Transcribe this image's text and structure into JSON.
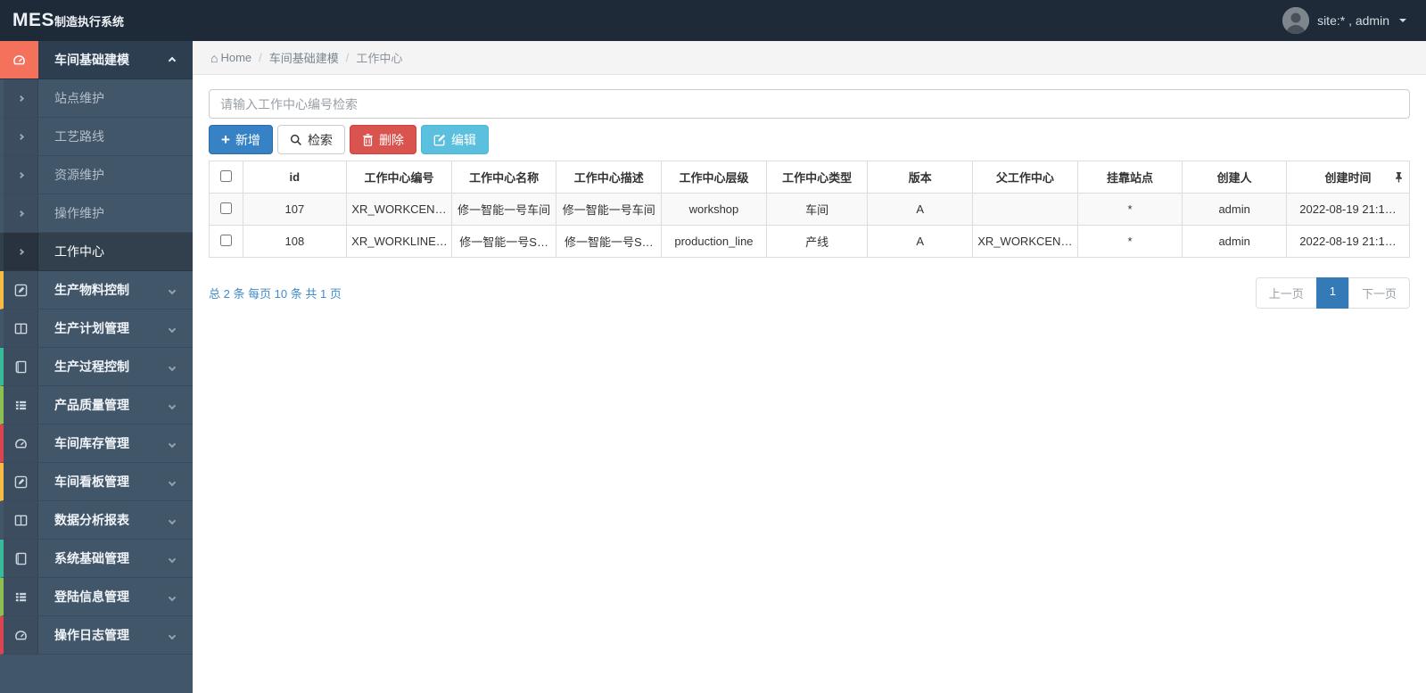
{
  "navbar": {
    "brand_bold": "MES",
    "brand_rest": "制造执行系统",
    "user_label": "site:* , admin"
  },
  "breadcrumb": {
    "home": "Home",
    "items": [
      "车间基础建模",
      "工作中心"
    ]
  },
  "sidebar": {
    "items": [
      {
        "label": "车间基础建模",
        "icon": "dashboard-icon",
        "kind": "parent",
        "expanded": true,
        "active": true,
        "icon_bg": "#f4715c"
      },
      {
        "label": "站点维护",
        "kind": "sub"
      },
      {
        "label": "工艺路线",
        "kind": "sub"
      },
      {
        "label": "资源维护",
        "kind": "sub"
      },
      {
        "label": "操作维护",
        "kind": "sub"
      },
      {
        "label": "工作中心",
        "kind": "sub",
        "active": true
      },
      {
        "label": "生产物料控制",
        "icon": "pencil-square-icon",
        "kind": "parent",
        "strip": "#f6bb42"
      },
      {
        "label": "生产计划管理",
        "icon": "columns-icon",
        "kind": "parent"
      },
      {
        "label": "生产过程控制",
        "icon": "book-icon",
        "kind": "parent",
        "strip": "#37bc9b"
      },
      {
        "label": "产品质量管理",
        "icon": "list-icon",
        "kind": "parent",
        "strip": "#8cc152"
      },
      {
        "label": "车间库存管理",
        "icon": "dashboard-icon",
        "kind": "parent",
        "strip": "#da4453"
      },
      {
        "label": "车间看板管理",
        "icon": "pencil-square-icon",
        "kind": "parent",
        "strip": "#f6bb42"
      },
      {
        "label": "数据分析报表",
        "icon": "columns-icon",
        "kind": "parent"
      },
      {
        "label": "系统基础管理",
        "icon": "book-icon",
        "kind": "parent",
        "strip": "#37bc9b"
      },
      {
        "label": "登陆信息管理",
        "icon": "list-icon",
        "kind": "parent",
        "strip": "#8cc152"
      },
      {
        "label": "操作日志管理",
        "icon": "dashboard-icon",
        "kind": "parent",
        "strip": "#da4453"
      }
    ]
  },
  "toolbar": {
    "search_placeholder": "请输入工作中心编号检索",
    "search_value": "",
    "buttons": [
      {
        "label": "新增",
        "icon": "plus-icon"
      },
      {
        "label": "检索",
        "icon": "search-icon"
      },
      {
        "label": "删除",
        "icon": "trash-icon"
      },
      {
        "label": "编辑",
        "icon": "edit-icon"
      }
    ]
  },
  "table": {
    "headers": [
      "id",
      "工作中心编号",
      "工作中心名称",
      "工作中心描述",
      "工作中心层级",
      "工作中心类型",
      "版本",
      "父工作中心",
      "挂靠站点",
      "创建人",
      "创建时间"
    ],
    "rows": [
      [
        "107",
        "XR_WORKCEN…",
        "修一智能一号车间",
        "修一智能一号车间",
        "workshop",
        "车间",
        "A",
        "",
        "*",
        "admin",
        "2022-08-19 21:1…"
      ],
      [
        "108",
        "XR_WORKLINE…",
        "修一智能一号S…",
        "修一智能一号S…",
        "production_line",
        "产线",
        "A",
        "XR_WORKCEN…",
        "*",
        "admin",
        "2022-08-19 21:1…"
      ]
    ]
  },
  "pagination": {
    "summary": "总 2 条 每页 10 条 共 1 页",
    "prev": "上一页",
    "current": "1",
    "next": "下一页"
  },
  "colors": {
    "navbar_bg": "#1e2a38",
    "sidebar_bg": "#42566a",
    "active_parent_bg": "#2c3e50",
    "active_icon_bg": "#f4715c",
    "primary": "#3782c4",
    "danger": "#d9534f",
    "info": "#5bc0de",
    "active_page": "#337ab7",
    "link_blue": "#428bca"
  }
}
